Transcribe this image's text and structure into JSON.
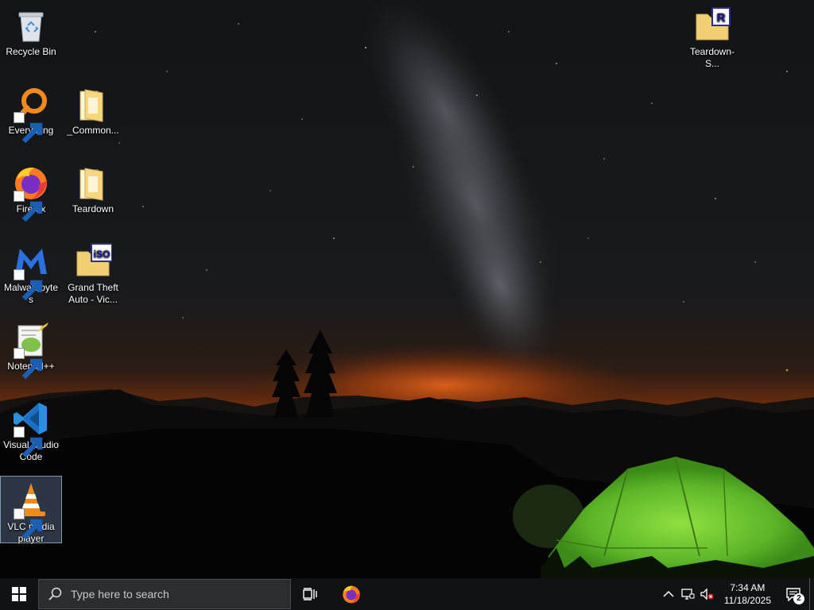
{
  "desktop": {
    "icons": [
      {
        "label": "Recycle Bin",
        "icon": "recycle-bin-icon"
      },
      {
        "label": "Everything",
        "icon": "everything-search-icon"
      },
      {
        "label": "_Common...",
        "icon": "folder-icon"
      },
      {
        "label": "Firefox",
        "icon": "firefox-icon"
      },
      {
        "label": "Teardown",
        "icon": "folder-icon"
      },
      {
        "label": "Malwarebytes",
        "icon": "malwarebytes-icon"
      },
      {
        "label": "Grand Theft Auto - Vic...",
        "icon": "iso-folder-icon"
      },
      {
        "label": "Notepad++",
        "icon": "notepad-plus-plus-icon"
      },
      {
        "label": "Visual Studio Code",
        "icon": "vscode-icon"
      },
      {
        "label": "VLC media player",
        "icon": "vlc-icon"
      },
      {
        "label": "Teardown-S...",
        "icon": "rar-folder-icon"
      }
    ]
  },
  "taskbar": {
    "search_placeholder": "Type here to search",
    "clock_time": "7:34 AM",
    "clock_date": "11/18/2025",
    "notification_count": "2"
  },
  "colors": {
    "taskbar_bg": "#101216",
    "search_bg": "#2b2d31",
    "tent_green": "#7fd43a",
    "horizon_glow": "#d8621a"
  }
}
